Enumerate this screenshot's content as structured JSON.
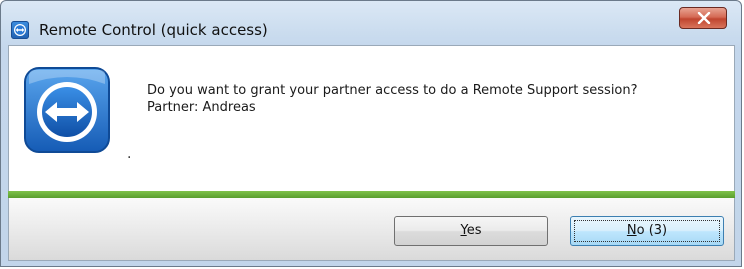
{
  "window": {
    "title": "Remote Control (quick access)",
    "app_icon": "teamviewer-icon",
    "close_icon": "close-icon"
  },
  "dialog": {
    "question": "Do you want to grant your partner access to do a Remote Support session?",
    "partner_line": "Partner: Andreas",
    "dot": "."
  },
  "buttons": {
    "yes_accel": "Y",
    "yes_rest": "es",
    "no_accel": "N",
    "no_rest": "o (3)"
  },
  "colors": {
    "accent_green": "#6ab23a",
    "logo_blue": "#1f6fd0",
    "close_red": "#c8452f"
  }
}
